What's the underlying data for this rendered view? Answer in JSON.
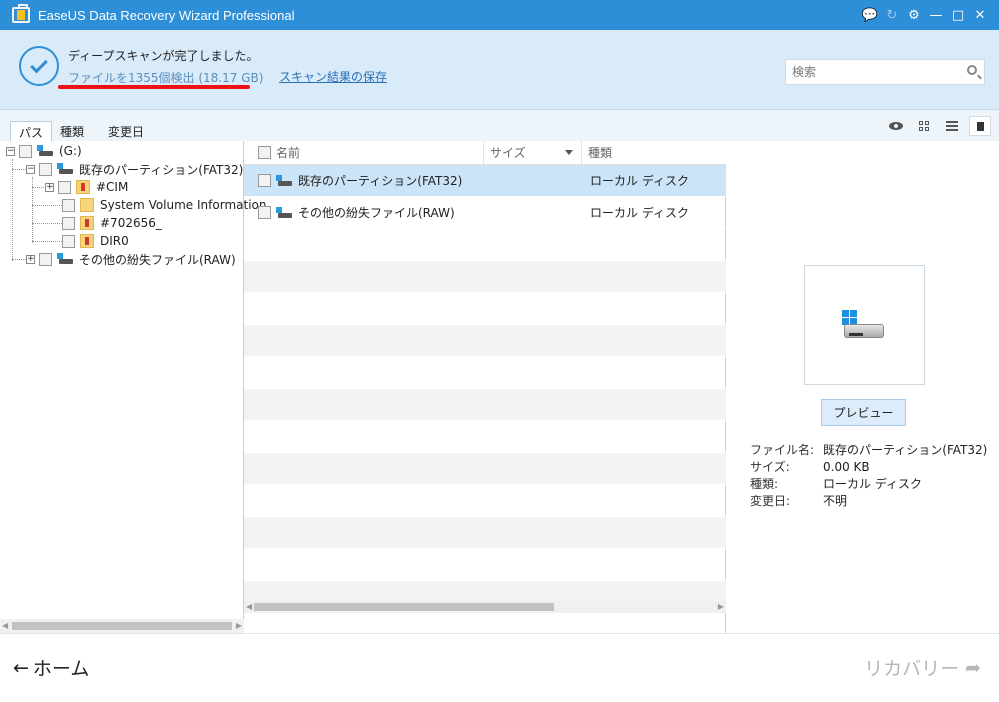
{
  "window": {
    "title": "EaseUS Data Recovery Wizard Professional"
  },
  "header": {
    "scan_status": "ディープスキャンが完了しました。",
    "found_summary": "ファイルを1355個検出 (18.17 GB)",
    "save_results_link": "スキャン結果の保存",
    "search_placeholder": "検索"
  },
  "tabs": [
    {
      "label": "パス",
      "active": true
    },
    {
      "label": "種類",
      "active": false
    },
    {
      "label": "変更日",
      "active": false
    }
  ],
  "tree": {
    "root": "(G:)",
    "items": [
      {
        "label": "既存のパーティション(FAT32)"
      },
      {
        "label": "#CIM"
      },
      {
        "label": "System Volume Information"
      },
      {
        "label": "#702656_"
      },
      {
        "label": "DIR0"
      },
      {
        "label": "その他の紛失ファイル(RAW)"
      }
    ]
  },
  "list": {
    "columns": {
      "name": "名前",
      "size": "サイズ",
      "type": "種類"
    },
    "rows": [
      {
        "name": "既存のパーティション(FAT32)",
        "size": "",
        "type": "ローカル ディスク"
      },
      {
        "name": "その他の紛失ファイル(RAW)",
        "size": "",
        "type": "ローカル ディスク"
      }
    ]
  },
  "preview": {
    "button_label": "プレビュー",
    "info": [
      {
        "label": "ファイル名:",
        "value": "既存のパーティション(FAT32)"
      },
      {
        "label": "サイズ:",
        "value": "0.00 KB"
      },
      {
        "label": "種類:",
        "value": "ローカル ディスク"
      },
      {
        "label": "変更日:",
        "value": "不明"
      }
    ]
  },
  "footer": {
    "home_label": "ホーム",
    "recover_label": "リカバリー"
  },
  "colors": {
    "titlebar": "#2d8fd8",
    "header_bg": "#d9ebf9",
    "selected_row": "#cce4f7",
    "annotation_red": "#ee1111"
  }
}
